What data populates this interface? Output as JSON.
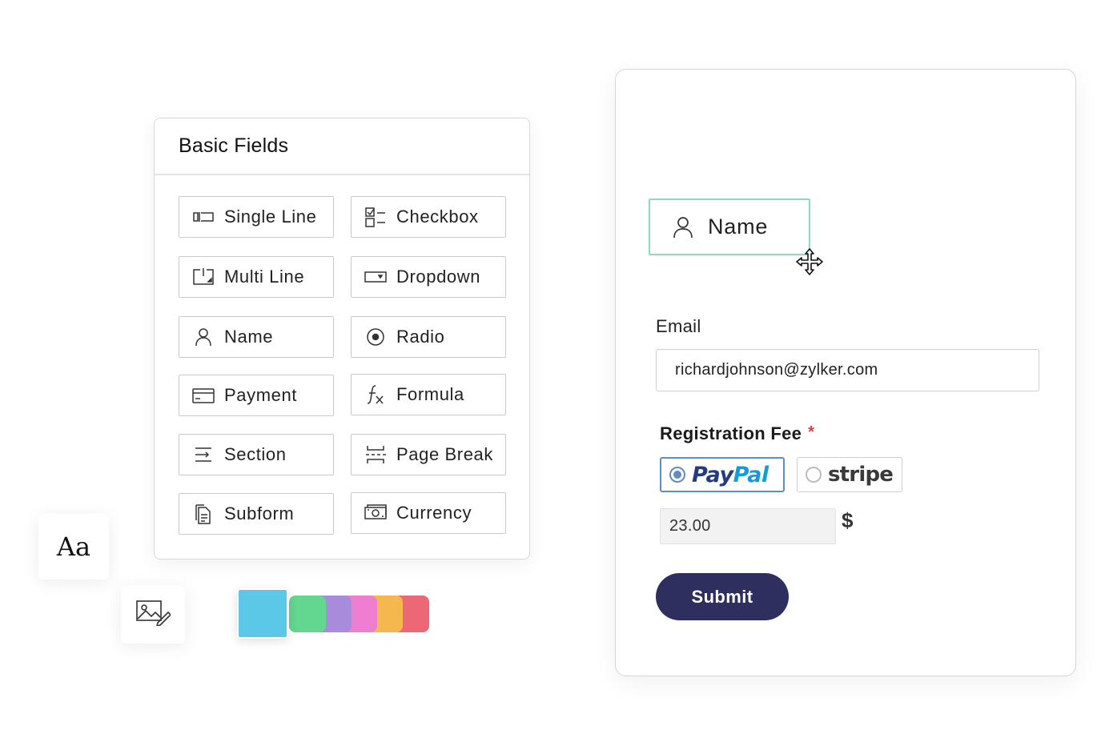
{
  "fields_panel": {
    "title": "Basic Fields",
    "fields": [
      {
        "label": "Single Line",
        "icon": "single-line-icon"
      },
      {
        "label": "Checkbox",
        "icon": "checkbox-icon"
      },
      {
        "label": "Multi Line",
        "icon": "multi-line-icon"
      },
      {
        "label": "Dropdown",
        "icon": "dropdown-icon"
      },
      {
        "label": "Name",
        "icon": "user-icon"
      },
      {
        "label": "Radio",
        "icon": "radio-icon"
      },
      {
        "label": "Payment",
        "icon": "card-icon"
      },
      {
        "label": "Formula",
        "icon": "formula-icon"
      },
      {
        "label": "Section",
        "icon": "section-icon"
      },
      {
        "label": "Page Break",
        "icon": "page-break-icon"
      },
      {
        "label": "Subform",
        "icon": "subform-icon"
      },
      {
        "label": "Currency",
        "icon": "currency-icon"
      }
    ]
  },
  "tools": {
    "font_sample": "Aa",
    "image_tool_icon": "image-edit-icon",
    "palette": {
      "selected": "#5bc8e8",
      "colors": [
        "#63d68f",
        "#a98bdc",
        "#ee7ecf",
        "#f5b84f",
        "#ec6876"
      ]
    }
  },
  "form": {
    "dragged_field": {
      "label": "Name",
      "icon": "user-icon",
      "cursor_icon": "move-cursor-icon"
    },
    "email": {
      "label": "Email",
      "value": "richardjohnson@zylker.com"
    },
    "registration_fee": {
      "label": "Registration Fee",
      "required_mark": "*",
      "options": [
        {
          "name": "PayPal",
          "part1": "Pay",
          "part2": "Pal",
          "selected": true
        },
        {
          "name": "stripe",
          "selected": false
        }
      ],
      "amount": "23.00",
      "currency_symbol": "$"
    },
    "submit_label": "Submit"
  },
  "colors": {
    "accent_border": "#8fd9c0",
    "submit_bg": "#2e2f5e",
    "paypal_border": "#5f8bc9",
    "required": "#e0403a"
  }
}
